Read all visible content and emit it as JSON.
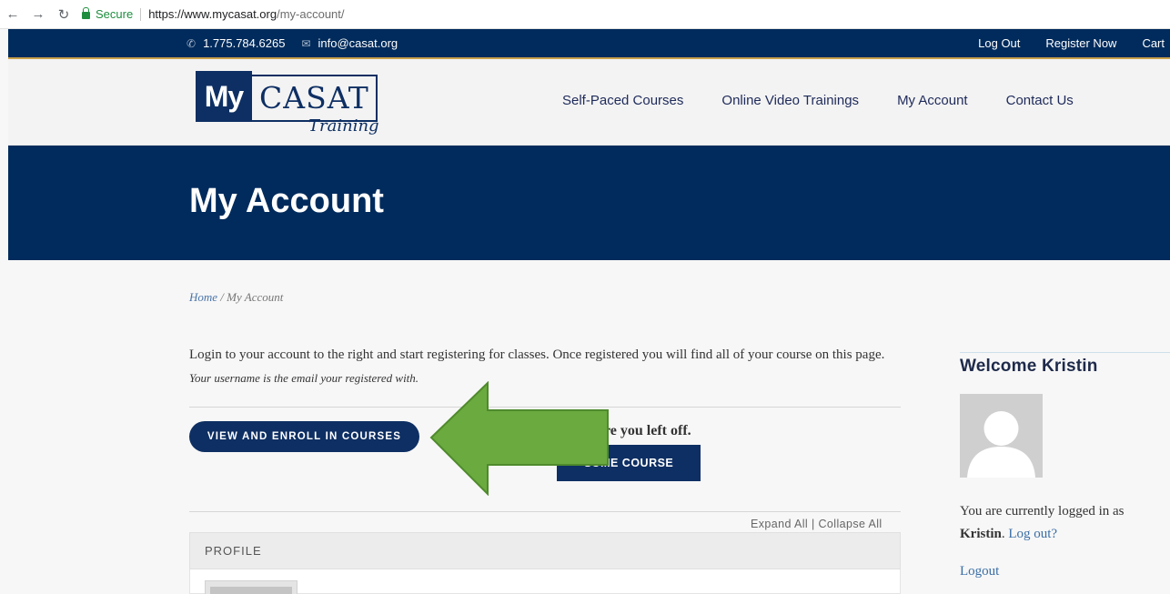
{
  "browser": {
    "secure_label": "Secure",
    "url_host": "https://www.mycasat.org",
    "url_path": "/my-account/"
  },
  "topbar": {
    "phone": "1.775.784.6265",
    "email": "info@casat.org",
    "links": [
      "Log Out",
      "Register Now",
      "Cart"
    ]
  },
  "logo": {
    "my": "My",
    "casat": "CASAT",
    "training": "Training"
  },
  "nav": {
    "items": [
      "Self-Paced Courses",
      "Online Video Trainings",
      "My Account",
      "Contact Us"
    ]
  },
  "hero": {
    "title": "My Account"
  },
  "breadcrumb": {
    "home": "Home",
    "separator": "/",
    "current": "My Account"
  },
  "intro": {
    "text": "Login to your account to the right and start registering for classes. Once registered you will find all of your course on this page.",
    "note": "Your username is the email your registered with."
  },
  "actions": {
    "enroll_label": "VIEW AND ENROLL IN COURSES",
    "resume_text": "me where you left off.",
    "resume_label": "SUME COURSE"
  },
  "courses": {
    "expand_all": "Expand All",
    "divider": "|",
    "collapse_all": "Collapse All",
    "profile_label": "PROFILE"
  },
  "sidebar": {
    "welcome": "Welcome Kristin",
    "logged_in_prefix": "You are currently logged in as",
    "username": "Kristin",
    "logout_question": "Log out?",
    "logout": "Logout"
  },
  "colors": {
    "navy": "#002b5c",
    "button": "#0e2f63",
    "arrow_green": "#6aaa3f",
    "link_blue": "#3a6ea5"
  }
}
